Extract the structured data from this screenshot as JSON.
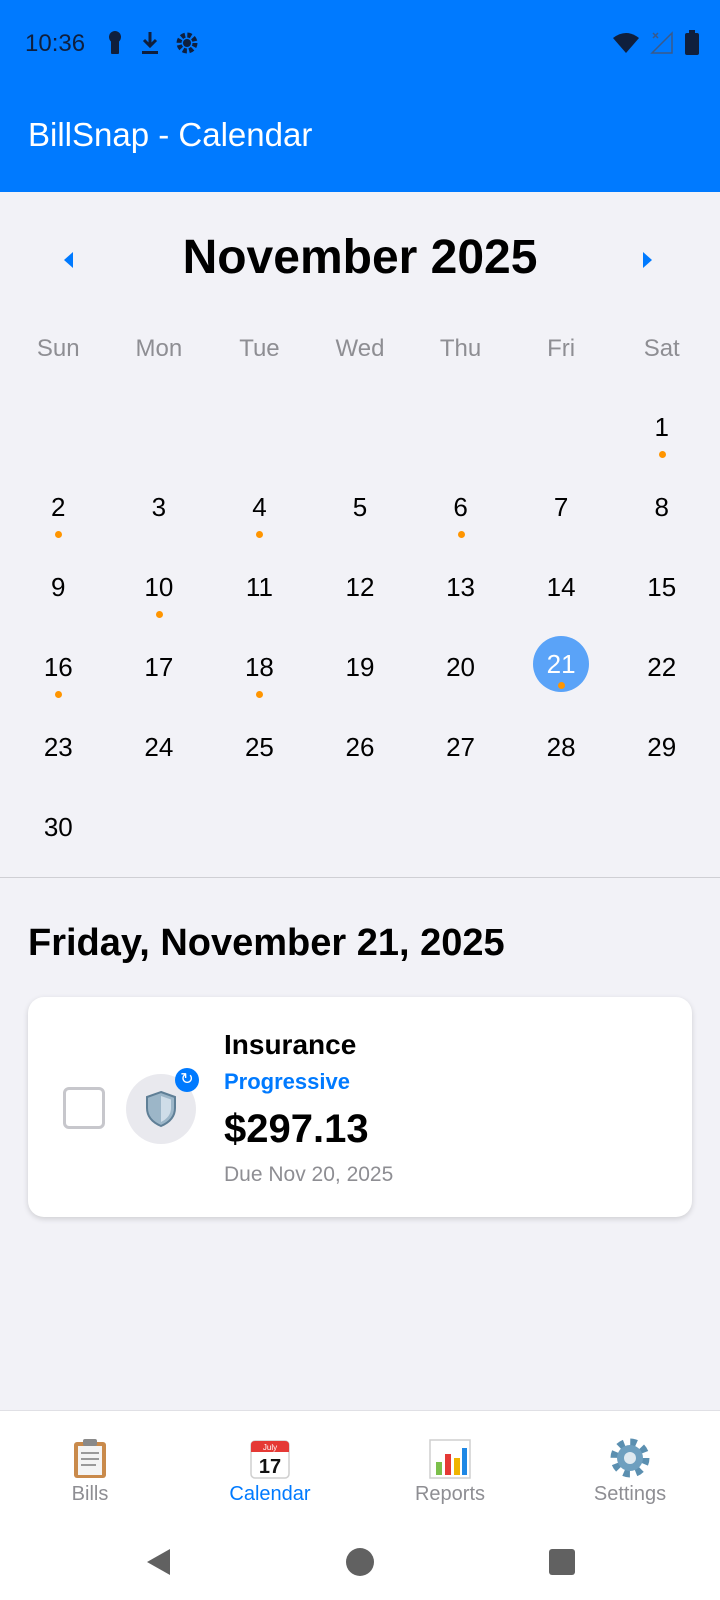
{
  "status_bar": {
    "time": "10:36",
    "icons_left": [
      "key-icon",
      "download-icon",
      "gear-icon"
    ],
    "icons_right": [
      "wifi-icon",
      "signal-icon",
      "battery-icon"
    ]
  },
  "app_bar": {
    "title": "BillSnap - Calendar"
  },
  "calendar": {
    "month_title": "November 2025",
    "weekdays": [
      "Sun",
      "Mon",
      "Tue",
      "Wed",
      "Thu",
      "Fri",
      "Sat"
    ],
    "first_weekday_index": 6,
    "days_in_month": 30,
    "selected_day": 21,
    "days_with_bills": [
      1,
      2,
      4,
      6,
      10,
      16,
      18,
      21
    ],
    "accent_color": "#007aff",
    "selected_color": "#5aa3f8",
    "dot_color": "#ff9500"
  },
  "selected_date": {
    "heading": "Friday, November 21, 2025"
  },
  "bills": [
    {
      "name": "Insurance",
      "payee": "Progressive",
      "amount": "$297.13",
      "due": "Due Nov 20, 2025",
      "icon": "shield-icon",
      "recurring_badge": "↻",
      "paid": false
    }
  ],
  "tabs": [
    {
      "label": "Bills",
      "icon": "clipboard-icon",
      "active": false
    },
    {
      "label": "Calendar",
      "icon": "calendar-icon",
      "active": true
    },
    {
      "label": "Reports",
      "icon": "bar-chart-icon",
      "active": false
    },
    {
      "label": "Settings",
      "icon": "gear-icon",
      "active": false
    }
  ],
  "calendar_icon_text": {
    "month": "July",
    "day": "17"
  }
}
